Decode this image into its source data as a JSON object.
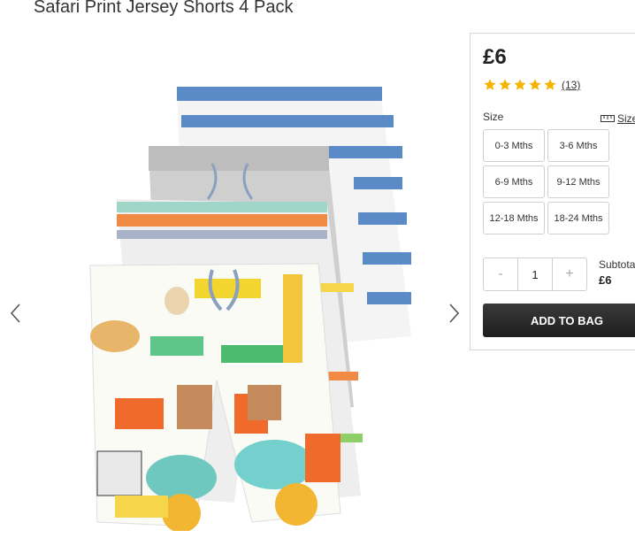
{
  "product": {
    "title": "Safari Print Jersey Shorts 4 Pack"
  },
  "gallery": {
    "prev_icon": "chevron-left-icon",
    "next_icon": "chevron-right-icon"
  },
  "panel": {
    "price": "£6",
    "rating": {
      "stars": 5,
      "count_text": "(13)",
      "color": "#f4b400"
    },
    "size_label": "Size",
    "size_guide_label": "Size",
    "sizes": [
      "0-3 Mths",
      "3-6 Mths",
      "6-9 Mths",
      "9-12 Mths",
      "12-18 Mths",
      "18-24 Mths"
    ],
    "quantity": {
      "minus": "-",
      "value": "1",
      "plus": "+"
    },
    "subtotal_label": "Subtotal",
    "subtotal_value": "£6",
    "add_to_bag": "ADD TO BAG"
  }
}
